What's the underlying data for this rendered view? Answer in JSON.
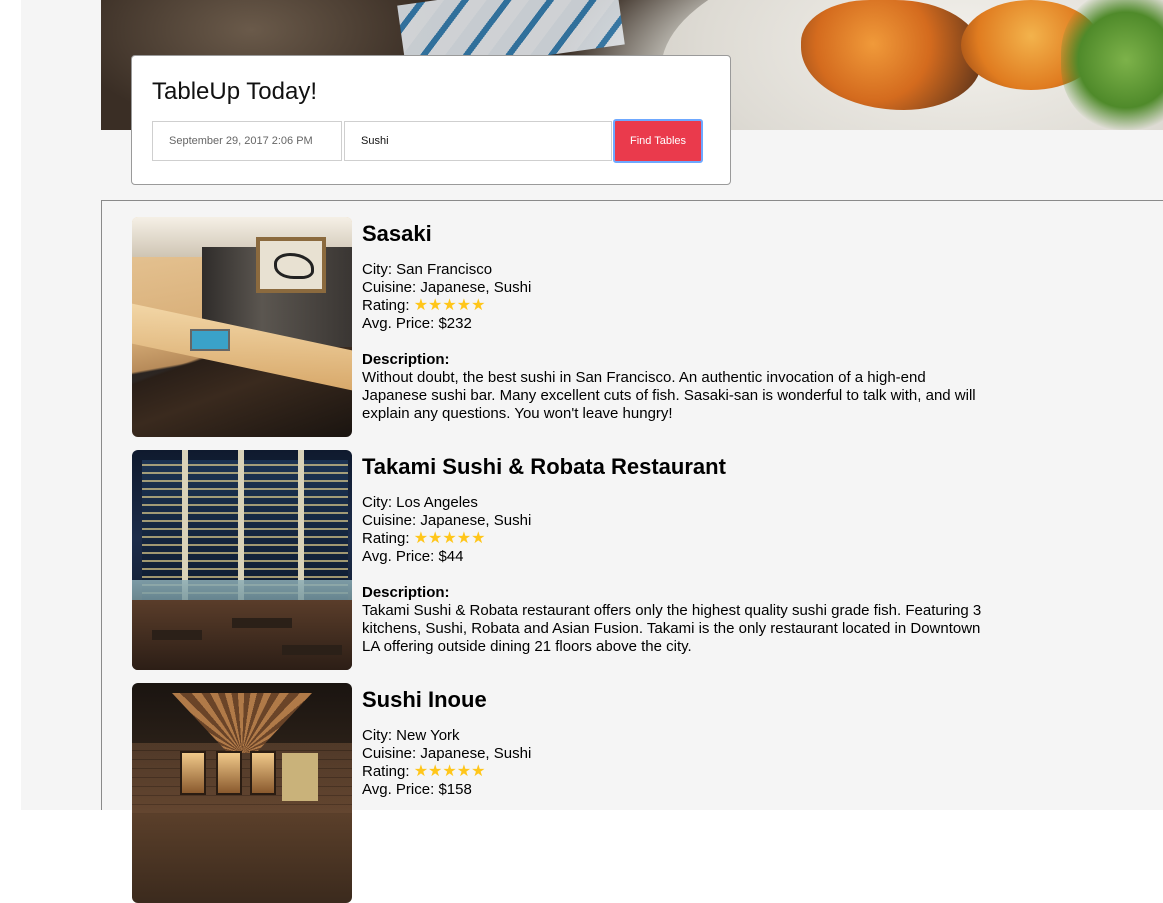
{
  "search": {
    "title": "TableUp Today!",
    "date_value": "September 29, 2017 2:06 PM",
    "query_value": "Sushi",
    "find_button_label": "Find Tables"
  },
  "labels": {
    "city": "City:",
    "cuisine": "Cuisine:",
    "rating": "Rating:",
    "avg_price": "Avg. Price:",
    "description": "Description:"
  },
  "rating_color": "#ffc61a",
  "accent_color": "#ea3a4c",
  "restaurants": [
    {
      "name": "Sasaki",
      "city": "San Francisco",
      "cuisine": "Japanese, Sushi",
      "rating_stars": "★★★★★",
      "rating": 5,
      "avg_price": "$232",
      "description": "Without doubt, the best sushi in San Francisco. An authentic invocation of a high-end Japanese sushi bar. Many excellent cuts of fish. Sasaki-san is wonderful to talk with, and will explain any questions. You won't leave hungry!"
    },
    {
      "name": "Takami Sushi & Robata Restaurant",
      "city": "Los Angeles",
      "cuisine": "Japanese, Sushi",
      "rating_stars": "★★★★★",
      "rating": 5,
      "avg_price": "$44",
      "description": "Takami Sushi & Robata restaurant offers only the highest quality sushi grade fish. Featuring 3 kitchens, Sushi, Robata and Asian Fusion. Takami is the only restaurant located in Downtown LA offering outside dining 21 floors above the city."
    },
    {
      "name": "Sushi Inoue",
      "city": "New York",
      "cuisine": "Japanese, Sushi",
      "rating_stars": "★★★★★",
      "rating": 5,
      "avg_price": "$158",
      "description": ""
    }
  ]
}
